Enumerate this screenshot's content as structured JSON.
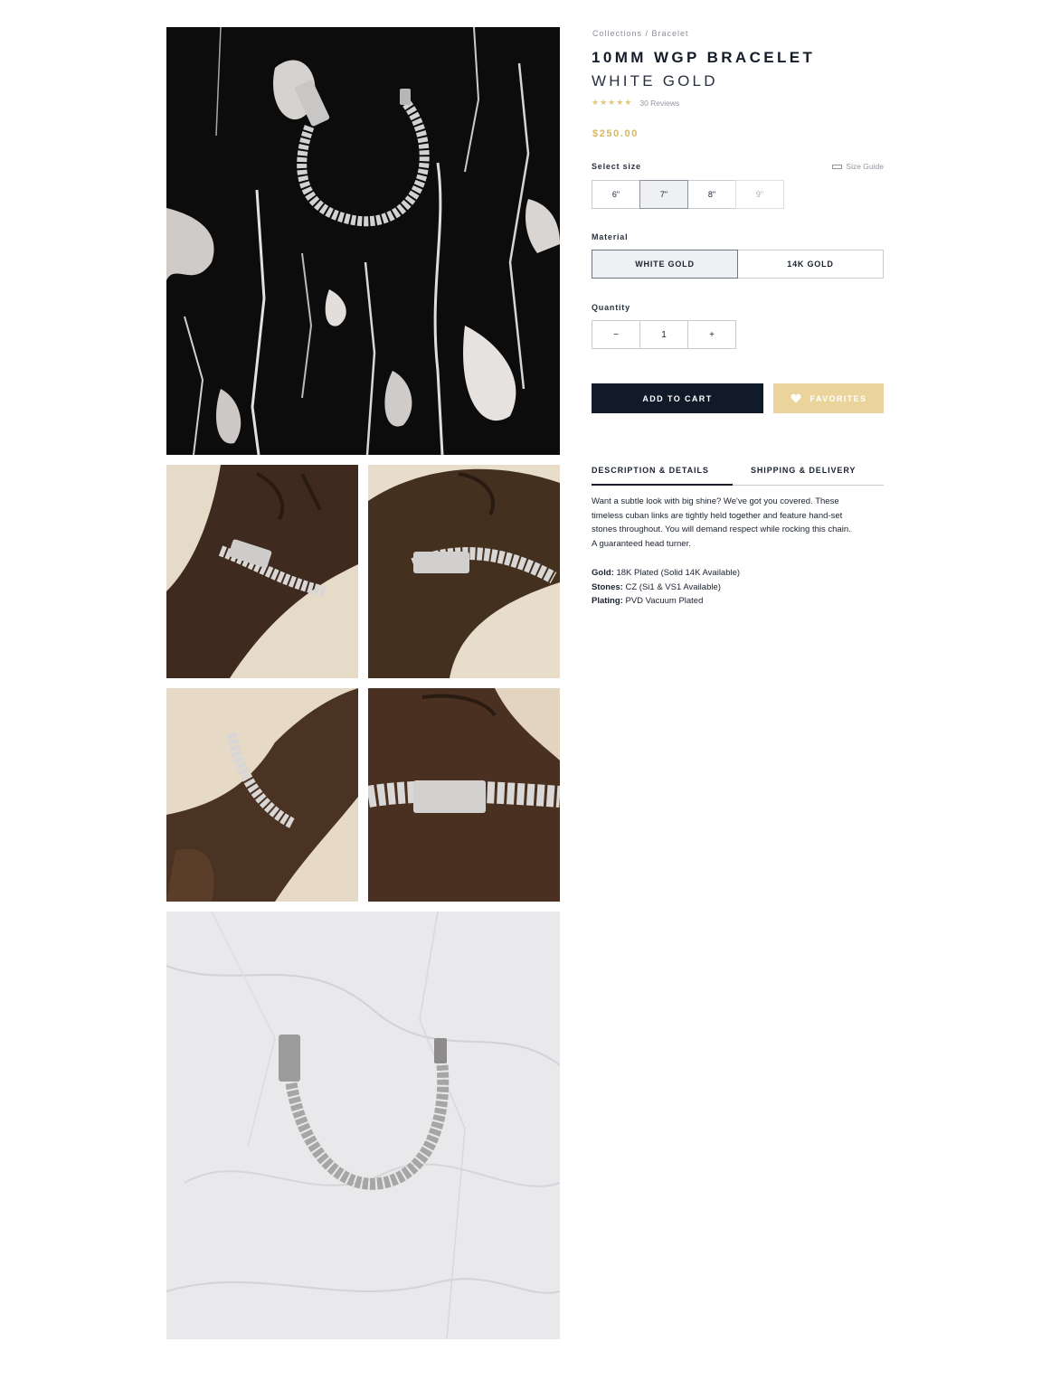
{
  "breadcrumb": "Collections / Bracelet",
  "product": {
    "title": "10MM WGP BRACELET",
    "subtitle": "WHITE GOLD",
    "stars": "★★★★★",
    "reviews": "30 Reviews",
    "price": "$250.00"
  },
  "size": {
    "label": "Select size",
    "guide_label": "Size Guide",
    "options": [
      "6\"",
      "7\"",
      "8\"",
      "9\""
    ],
    "selected": "7\""
  },
  "material": {
    "label": "Material",
    "options": [
      "WHITE GOLD",
      "14K GOLD"
    ],
    "selected": "WHITE GOLD"
  },
  "quantity": {
    "label": "Quantity",
    "minus": "−",
    "value": "1",
    "plus": "+"
  },
  "actions": {
    "add_to_cart": "ADD TO CART",
    "favorites": "FAVORITES"
  },
  "tabs": {
    "description": "DESCRIPTION & DETAILS",
    "shipping": "SHIPPING & DELIVERY"
  },
  "description": {
    "lines": [
      "Want a subtle look with big shine? We've got you covered. These",
      "timeless cuban links are tightly held together and feature hand-set",
      "stones throughout. You will demand respect while rocking this chain.",
      "A guaranteed head turner."
    ]
  },
  "specs": [
    {
      "key": "Gold:",
      "value": " 18K Plated (Solid 14K Available)"
    },
    {
      "key": "Stones:",
      "value": " CZ (Si1 & VS1 Available)"
    },
    {
      "key": "Plating:",
      "value": " PVD Vacuum Plated"
    }
  ],
  "icons": {
    "ruler": "ruler-icon",
    "heart": "heart-icon",
    "star": "star-icon"
  },
  "colors": {
    "navy": "#111a29",
    "gold": "#d8b65e",
    "favorites_bg": "#ead49c",
    "star": "#e2c77a"
  }
}
